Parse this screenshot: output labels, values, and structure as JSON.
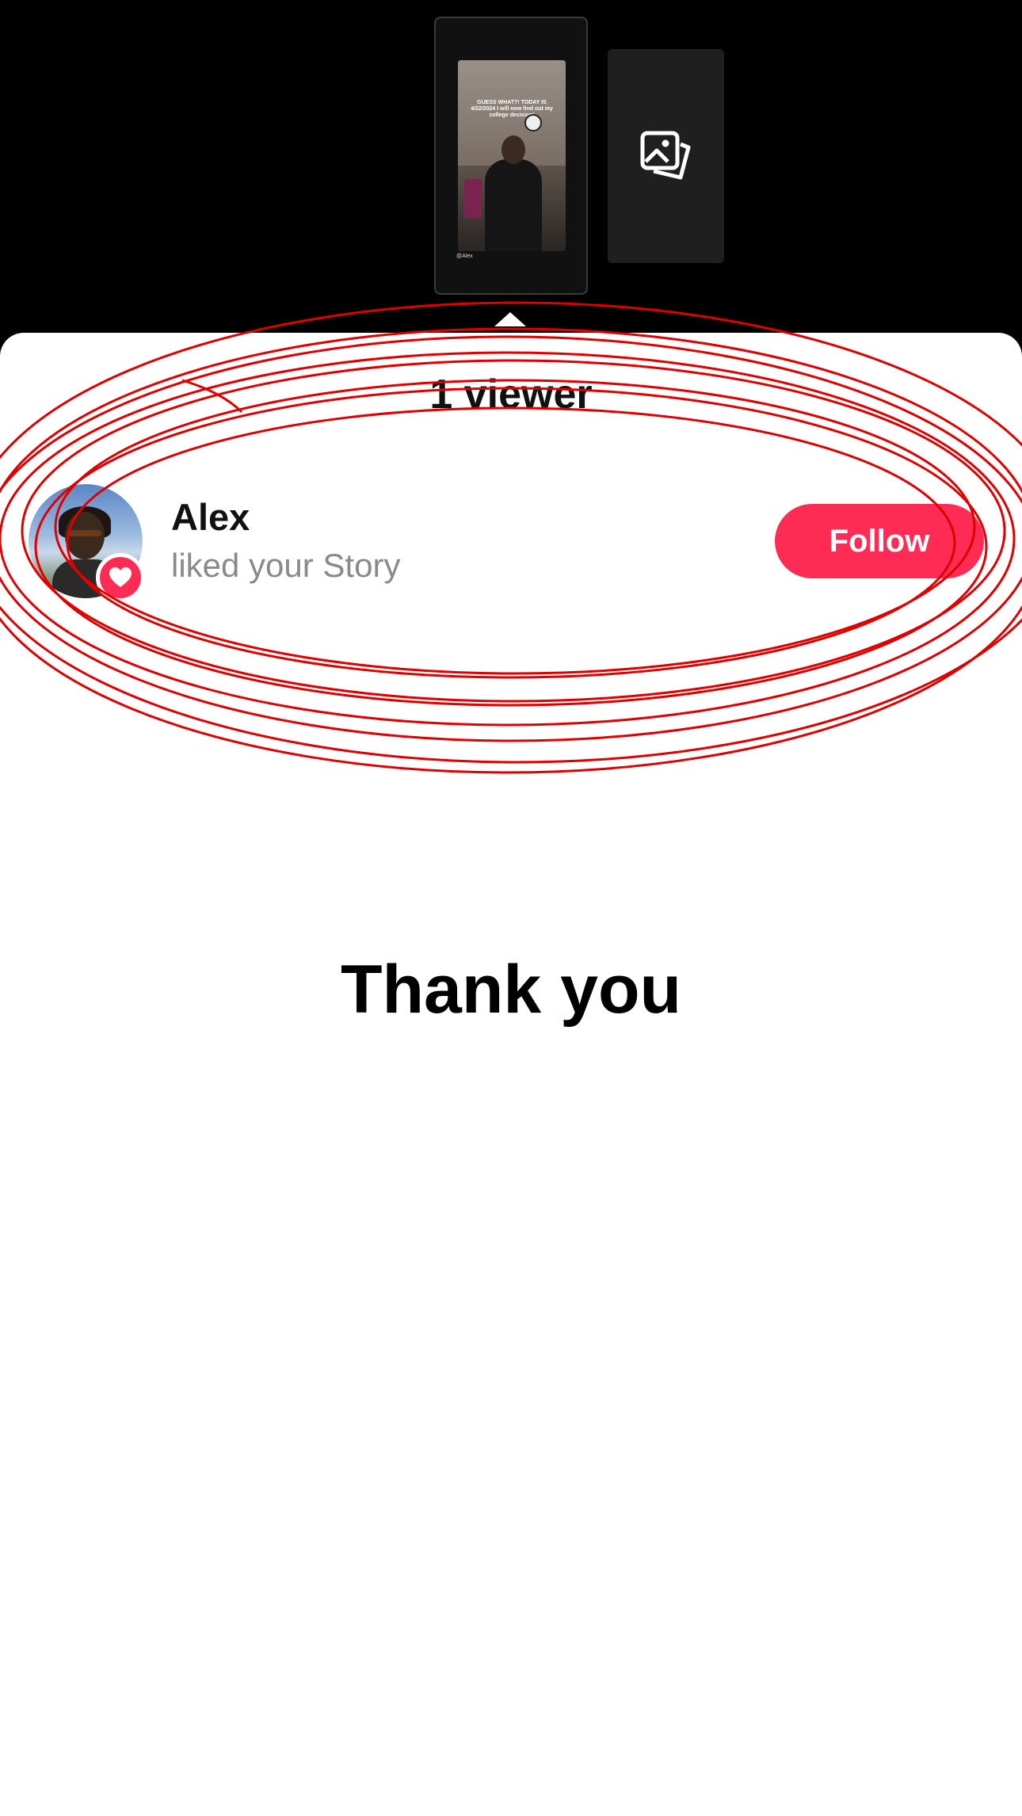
{
  "story_preview": {
    "caption": "GUESS WHAT?! TODAY IS 4/22/2024 I will now find out my college decision!",
    "handle": "@Alex"
  },
  "add_media": {
    "icon": "photos-icon"
  },
  "viewers": {
    "title": "1 viewer",
    "items": [
      {
        "name": "Alex",
        "action": "liked your Story",
        "button_label": "Follow",
        "badge_icon": "heart-icon"
      }
    ]
  },
  "message": "Thank you",
  "colors": {
    "accent": "#fe2c55",
    "annotation": "#e00000"
  }
}
